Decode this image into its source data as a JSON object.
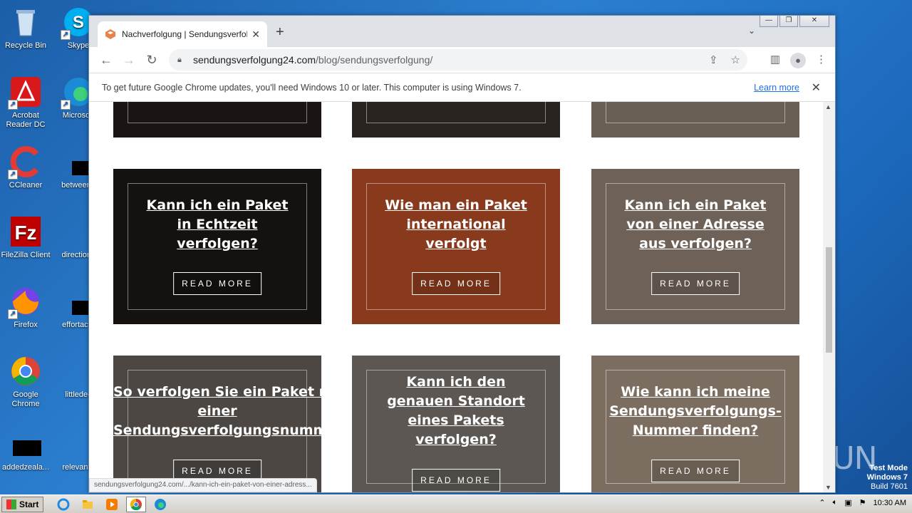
{
  "desktop": {
    "icons": [
      {
        "label": "Recycle Bin"
      },
      {
        "label": "Skype"
      },
      {
        "label": "Acrobat Reader DC"
      },
      {
        "label": "Microsoft"
      },
      {
        "label": "CCleaner"
      },
      {
        "label": "betweeng"
      },
      {
        "label": "FileZilla Client"
      },
      {
        "label": "directions"
      },
      {
        "label": "Firefox"
      },
      {
        "label": "effortacth"
      },
      {
        "label": "Google Chrome"
      },
      {
        "label": "littledec"
      },
      {
        "label": "addedzeala..."
      },
      {
        "label": "relevante"
      }
    ],
    "watermark_line1": "Test Mode",
    "watermark_line2": "Windows 7",
    "watermark_line3": "Build 7601",
    "anyrun": "ANY RUN"
  },
  "browser": {
    "tab_title": "Nachverfolgung | Sendungsverfolgu",
    "tab_close": "✕",
    "new_tab": "+",
    "tab_search": "⌄",
    "url_host": "sendungsverfolgung24.com",
    "url_path": "/blog/sendungsverfolgung/",
    "infobar_text": "To get future Google Chrome updates, you'll need Windows 10 or later. This computer is using Windows 7.",
    "infobar_link": "Learn more",
    "status_url": "sendungsverfolgung24.com/.../kann-ich-ein-paket-von-einer-adress..."
  },
  "cards": [
    {
      "title": "Kann ich ein Paket\nin Echtzeit\nverfolgen?",
      "button": "READ MORE",
      "bg": "#15110f"
    },
    {
      "title": "Wie man ein Paket\ninternational\nverfolgt",
      "button": "READ MORE",
      "bg": "#8a3a1c"
    },
    {
      "title": "Kann ich ein Paket\nvon einer Adresse\naus verfolgen?",
      "button": "READ MORE",
      "bg": "#6e6258"
    },
    {
      "title": "So verfolgen Sie ein Paket mit\neiner\nSendungsverfolgungsnummer",
      "button": "READ MORE",
      "bg": "#4c4743"
    },
    {
      "title": "Kann ich den\ngenauen Standort\neines Pakets\nverfolgen?",
      "button": "READ MORE",
      "bg": "#5c5753"
    },
    {
      "title": "Wie kann ich meine\nSendungsverfolgungs-\nNummer finden?",
      "button": "READ MORE",
      "bg": "#7b6e60"
    }
  ],
  "taskbar": {
    "start_label": "Start",
    "clock": "10:30 AM"
  }
}
